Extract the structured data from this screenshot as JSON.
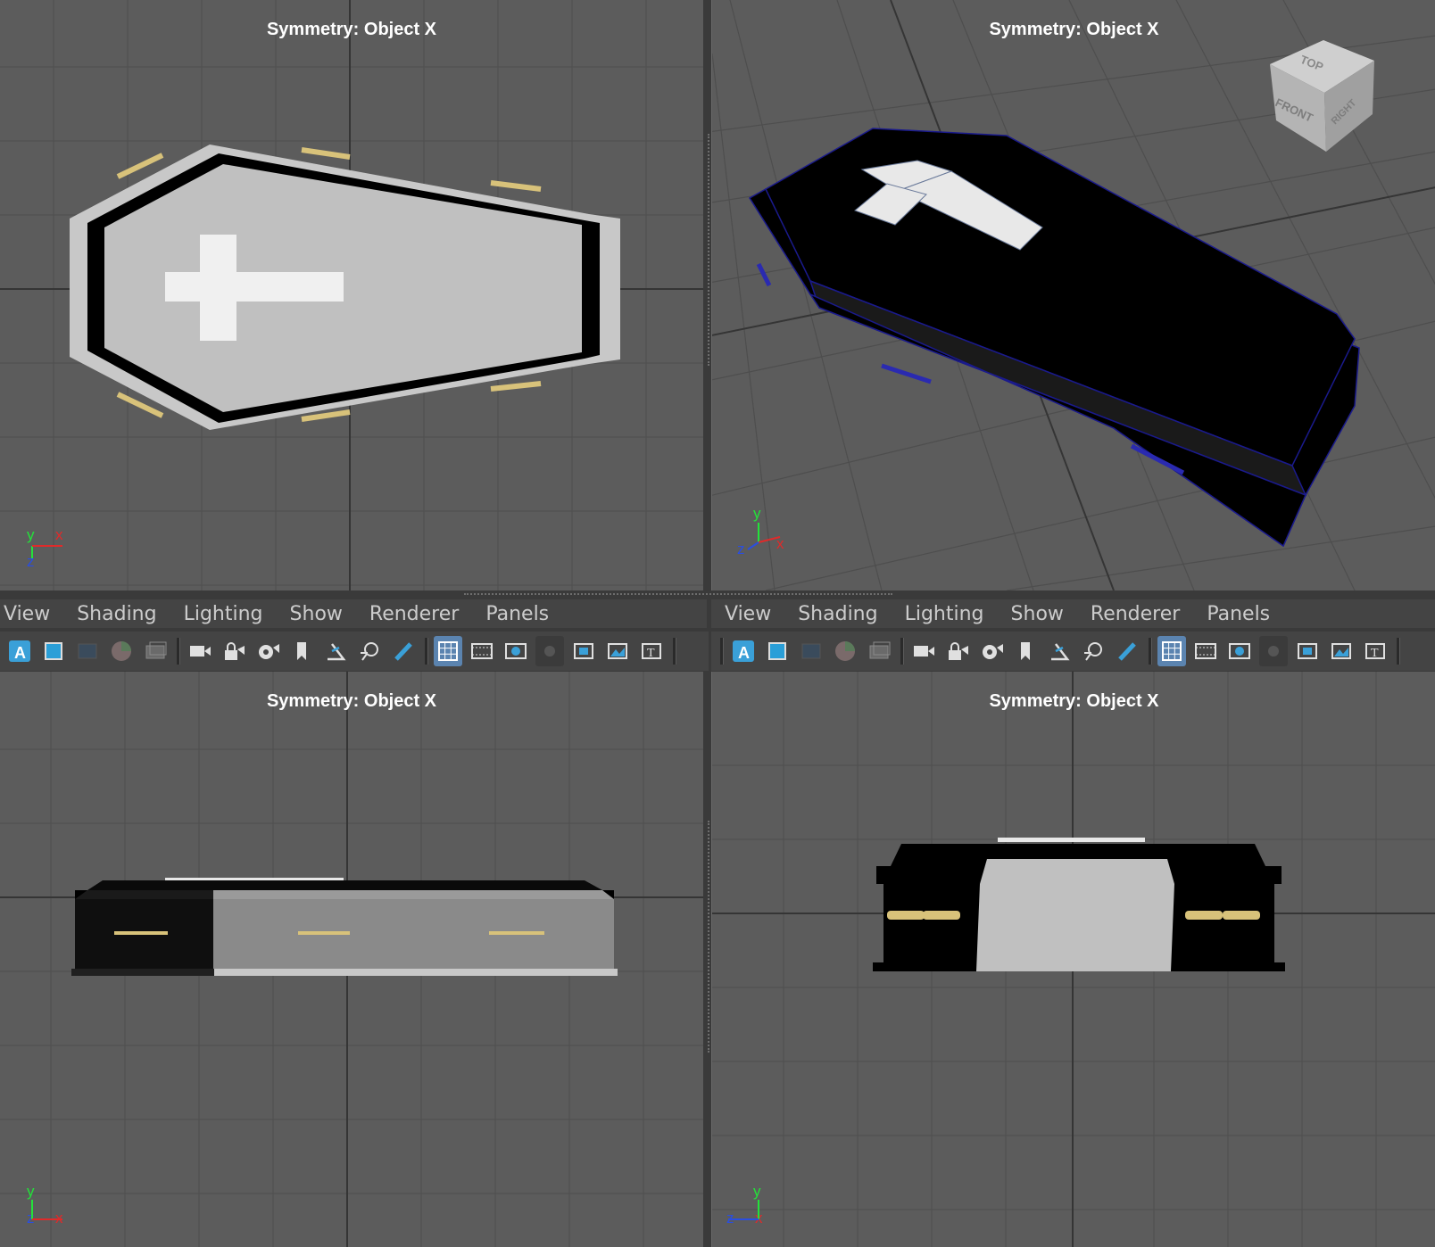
{
  "viewports": {
    "top": {
      "symmetry": "Symmetry: Object X",
      "axes": {
        "y": "y",
        "x": "x",
        "z": "z"
      }
    },
    "persp": {
      "symmetry": "Symmetry: Object X",
      "axes": {
        "y": "y",
        "x": "x",
        "z": "z"
      },
      "viewcube": {
        "top": "TOP",
        "front": "FRONT",
        "right": "RIGHT"
      }
    },
    "front": {
      "symmetry": "Symmetry: Object X",
      "axes": {
        "y": "y",
        "x": "x",
        "z": "z"
      }
    },
    "side": {
      "symmetry": "Symmetry: Object X",
      "axes": {
        "y": "y",
        "x": "x",
        "z": "z"
      }
    }
  },
  "menus": {
    "left": [
      "View",
      "Shading",
      "Lighting",
      "Show",
      "Renderer",
      "Panels"
    ],
    "right": [
      "View",
      "Shading",
      "Lighting",
      "Show",
      "Renderer",
      "Panels"
    ]
  },
  "toolbar_icons": [
    "select-camera-icon",
    "camera-attributes-icon",
    "bookmarks-icon",
    "image-plane-icon",
    "2d-pan-zoom-icon",
    "grease-pencil-icon",
    "camera-icon",
    "lock-camera-icon",
    "camera-settings-icon",
    "bookmark-icon",
    "snap-icon",
    "zoom-icon",
    "pencil-icon",
    "grid-icon",
    "film-gate-icon",
    "resolution-gate-icon",
    "gate-mask-icon",
    "field-chart-icon",
    "safe-action-icon",
    "safe-title-icon"
  ],
  "colors": {
    "viewport_bg": "#5c5c5c",
    "grid": "#4e4e4e",
    "grid_axis": "#353535",
    "coffin": "#000000",
    "lid_gray": "#c0c0c0",
    "handle_gold": "#d8c27a",
    "wire_blue": "#1a1a8c",
    "toolbar_active": "#5b84b0"
  }
}
